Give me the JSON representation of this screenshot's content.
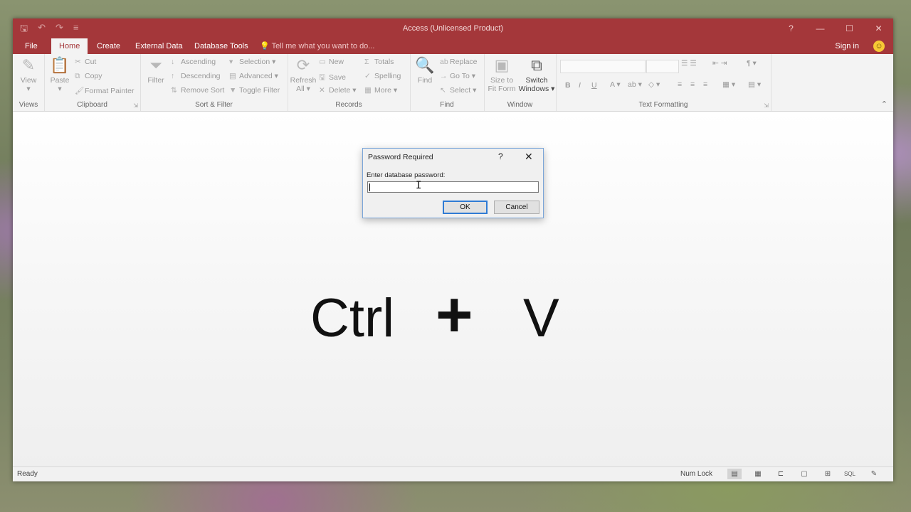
{
  "window": {
    "title": "Access (Unlicensed Product)"
  },
  "quick_access": {
    "save_icon": "save-icon",
    "undo_icon": "undo-icon",
    "redo_icon": "redo-icon",
    "customize_icon": "customize-icon"
  },
  "window_controls": {
    "help": "?",
    "minimize": "—",
    "maximize": "☐",
    "close": "✕"
  },
  "tabs": [
    {
      "label": "File"
    },
    {
      "label": "Home"
    },
    {
      "label": "Create"
    },
    {
      "label": "External Data"
    },
    {
      "label": "Database Tools"
    }
  ],
  "tell_me": "Tell me what you want to do...",
  "sign_in": "Sign in",
  "ribbon": {
    "views": {
      "view": "View",
      "label": "Views"
    },
    "clipboard": {
      "paste": "Paste",
      "cut": "Cut",
      "copy": "Copy",
      "format_painter": "Format Painter",
      "label": "Clipboard"
    },
    "sort_filter": {
      "filter": "Filter",
      "ascending": "Ascending",
      "descending": "Descending",
      "remove_sort": "Remove Sort",
      "selection": "Selection",
      "advanced": "Advanced",
      "toggle_filter": "Toggle Filter",
      "label": "Sort & Filter"
    },
    "records": {
      "refresh": "Refresh",
      "refresh_all": "All",
      "new": "New",
      "save": "Save",
      "delete": "Delete",
      "totals": "Totals",
      "spelling": "Spelling",
      "more": "More",
      "label": "Records"
    },
    "find": {
      "find": "Find",
      "replace": "Replace",
      "goto": "Go To",
      "select": "Select",
      "label": "Find"
    },
    "window": {
      "size_to": "Size to",
      "fit_form": "Fit Form",
      "switch": "Switch",
      "windows": "Windows",
      "label": "Window"
    },
    "text_formatting": {
      "bold": "B",
      "italic": "I",
      "underline": "U",
      "label": "Text Formatting"
    }
  },
  "dialog": {
    "title": "Password Required",
    "help": "?",
    "close": "✕",
    "prompt": "Enter database password:",
    "password_value": "",
    "ok": "OK",
    "cancel": "Cancel"
  },
  "overlay": {
    "key1": "Ctrl",
    "plus": "+",
    "key2": "V"
  },
  "status": {
    "ready": "Ready",
    "num_lock": "Num Lock"
  }
}
